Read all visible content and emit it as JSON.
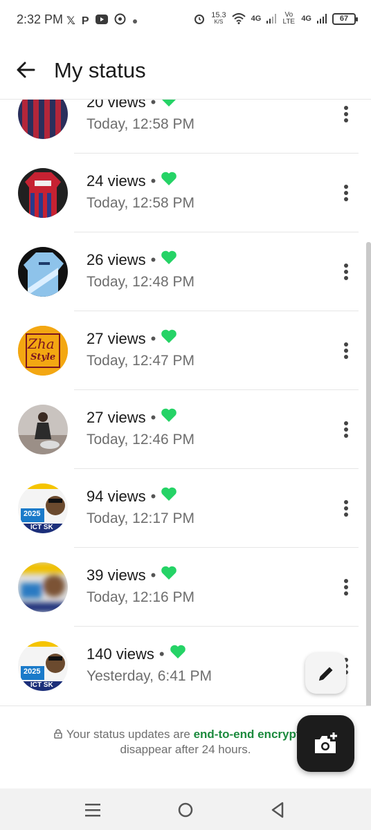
{
  "status_bar": {
    "time": "2:32 PM",
    "notification_icons": [
      "x-icon",
      "p-icon",
      "youtube-icon",
      "whatsapp-icon",
      "dot-icon"
    ],
    "speed": "15.3",
    "speed_unit": "K/S",
    "network_1": "4G",
    "volte": "Vo LTE",
    "network_2": "4G",
    "battery": "67"
  },
  "header": {
    "back_icon": "arrow-left-icon",
    "title": "My status"
  },
  "status_items": [
    {
      "views": "20 views",
      "separator": "•",
      "time": "Today, 12:58 PM",
      "avatar": "red-blue-jersey"
    },
    {
      "views": "24 views",
      "separator": "•",
      "time": "Today, 12:58 PM",
      "avatar": "red-emirates-jersey"
    },
    {
      "views": "26 views",
      "separator": "•",
      "time": "Today, 12:48 PM",
      "avatar": "sky-blue-jersey"
    },
    {
      "views": "27 views",
      "separator": "•",
      "time": "Today, 12:47 PM",
      "avatar": "zha-style-logo"
    },
    {
      "views": "27 views",
      "separator": "•",
      "time": "Today, 12:46 PM",
      "avatar": "person-photo"
    },
    {
      "views": "94 views",
      "separator": "•",
      "time": "Today, 12:17 PM",
      "avatar": "ict-flyer"
    },
    {
      "views": "39 views",
      "separator": "•",
      "time": "Today, 12:16 PM",
      "avatar": "blurred-image"
    },
    {
      "views": "140 views",
      "separator": "•",
      "time": "Yesterday, 6:41 PM",
      "avatar": "ict-flyer"
    }
  ],
  "avatar_text": {
    "zha_top": "Zha",
    "zha_bottom": "Style",
    "ict_year": "2025",
    "ict_label": "ICT SK"
  },
  "footer": {
    "prefix": "Your status updates are ",
    "link": "end-to-end encrypted",
    "suffix": ".",
    "line2": "disappear after 24 hours."
  },
  "colors": {
    "heart": "#25d366",
    "encrypted_link": "#1b8a3d",
    "camera_fab": "#1c1c1c"
  },
  "fabs": {
    "pen_icon": "pencil-icon",
    "camera_icon": "camera-plus-icon"
  },
  "nav": {
    "items": [
      "menu-icon",
      "home-circle-icon",
      "back-triangle-icon"
    ]
  }
}
